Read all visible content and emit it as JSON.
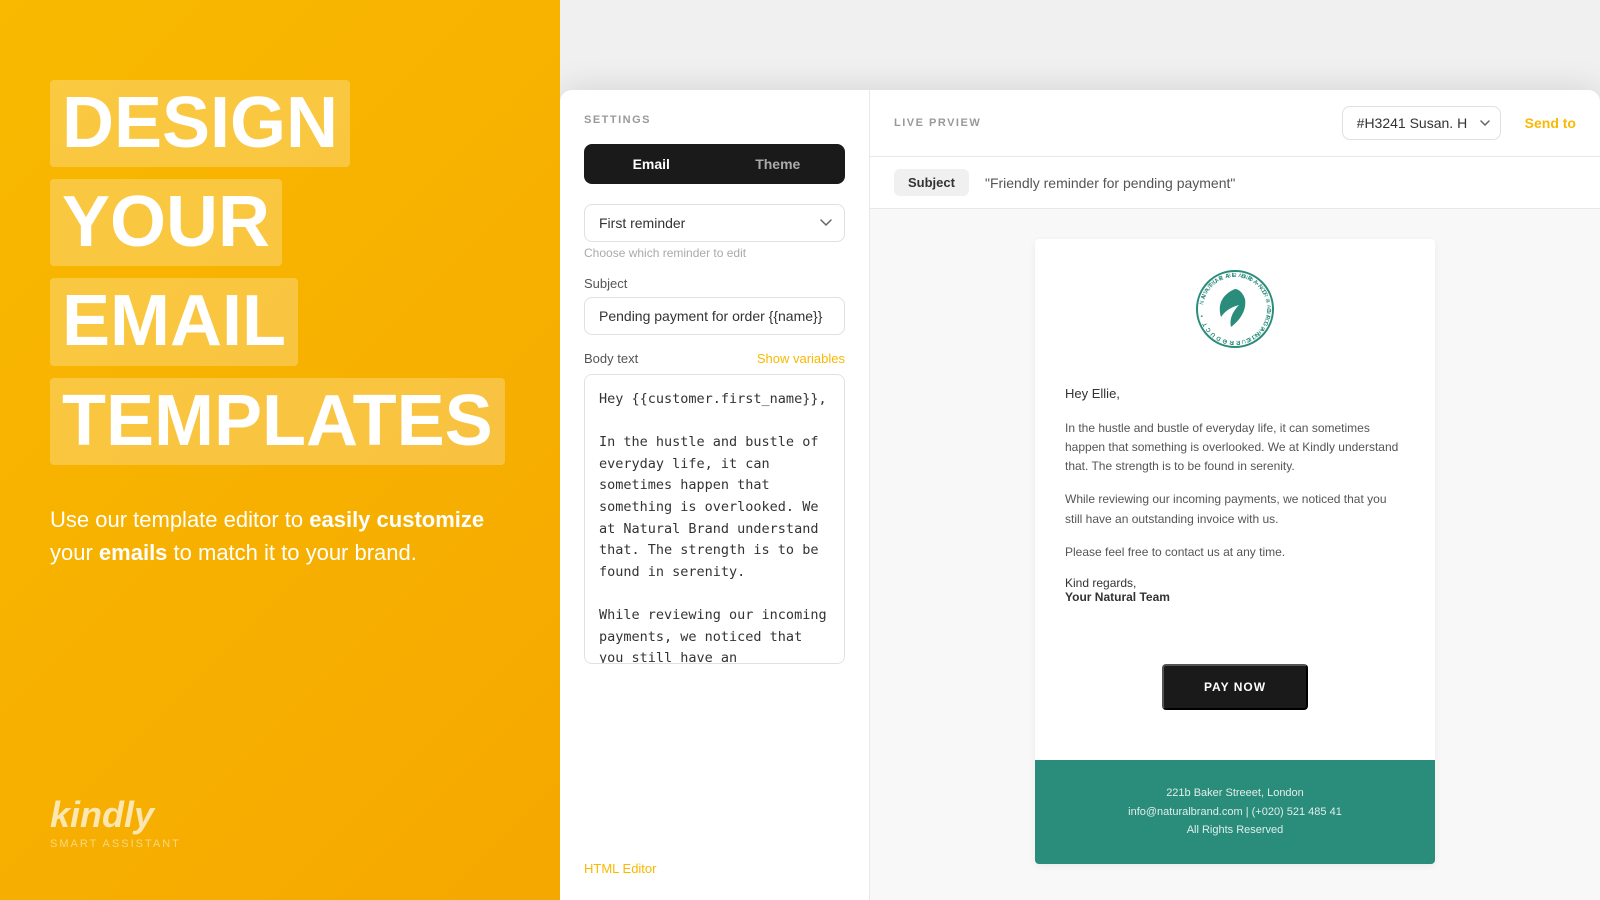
{
  "left": {
    "hero_lines": [
      [
        "DESIGN"
      ],
      [
        "YOUR",
        "EMAIL"
      ],
      [
        "TEMPLATES"
      ]
    ],
    "subtitle_plain": "Use our template editor to ",
    "subtitle_bold1": "easily customize",
    "subtitle_mid": " your ",
    "subtitle_bold2": "emails",
    "subtitle_end": " to match it to your brand.",
    "logo_text": "kindly",
    "logo_sub": "smart assistant"
  },
  "settings": {
    "section_title": "SETTINGS",
    "tab_email": "Email",
    "tab_theme": "Theme",
    "reminder_label": "First reminder",
    "reminder_hint": "Choose which reminder to edit",
    "subject_label": "Subject",
    "subject_value": "Pending payment for order {{name}}",
    "body_label": "Body text",
    "show_variables": "Show variables",
    "body_text": "Hey {{customer.first_name}},\n\nIn the hustle and bustle of everyday life, it can sometimes happen that something is overlooked. We at Natural Brand understand that. The strength is to be found in serenity.\n\nWhile reviewing our incoming payments, we noticed that  you still have an outstanding invoice with us. Please feel free to contact us at any time.\n\nKind regards,\nYour Kindly Team",
    "html_editor": "HTML Editor"
  },
  "preview": {
    "section_title": "LIVE PRVIEW",
    "ticket_select": "#H3241 Susan. H",
    "send_label": "Send to",
    "subject_label": "Subject",
    "subject_value": "\"Friendly reminder for pending payment\"",
    "email": {
      "greeting": "Hey Ellie,",
      "para1": "In the hustle and bustle of everyday life, it can sometimes happen that something is overlooked. We at Kindly understand that. The strength is to be found in serenity.",
      "para2": "While reviewing our incoming payments, we noticed that you still have an outstanding invoice with us.",
      "para3": "Please feel free to contact us at any time.",
      "sign_off": "Kind regards,",
      "team": "Your Natural Team",
      "pay_now": "PAY NOW",
      "footer_address": "221b Baker Streeet, London",
      "footer_email": "info@naturalbrand.com | (+020) 521 485 41",
      "footer_rights": "All Rights Reserved"
    }
  }
}
